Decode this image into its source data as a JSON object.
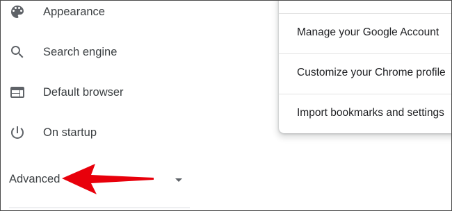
{
  "sidebar": {
    "items": [
      {
        "label": "Appearance",
        "icon": "palette-icon"
      },
      {
        "label": "Search engine",
        "icon": "search-icon"
      },
      {
        "label": "Default browser",
        "icon": "browser-window-icon"
      },
      {
        "label": "On startup",
        "icon": "power-icon"
      }
    ],
    "advanced": {
      "label": "Advanced",
      "icon": "caret-down-icon"
    }
  },
  "menu": {
    "items": [
      {
        "label": "Manage your Google Account"
      },
      {
        "label": "Customize your Chrome profile"
      },
      {
        "label": "Import bookmarks and settings"
      }
    ]
  },
  "colors": {
    "text": "#3c4043",
    "icon": "#5f6368",
    "annotation_arrow": "#e8000b"
  }
}
